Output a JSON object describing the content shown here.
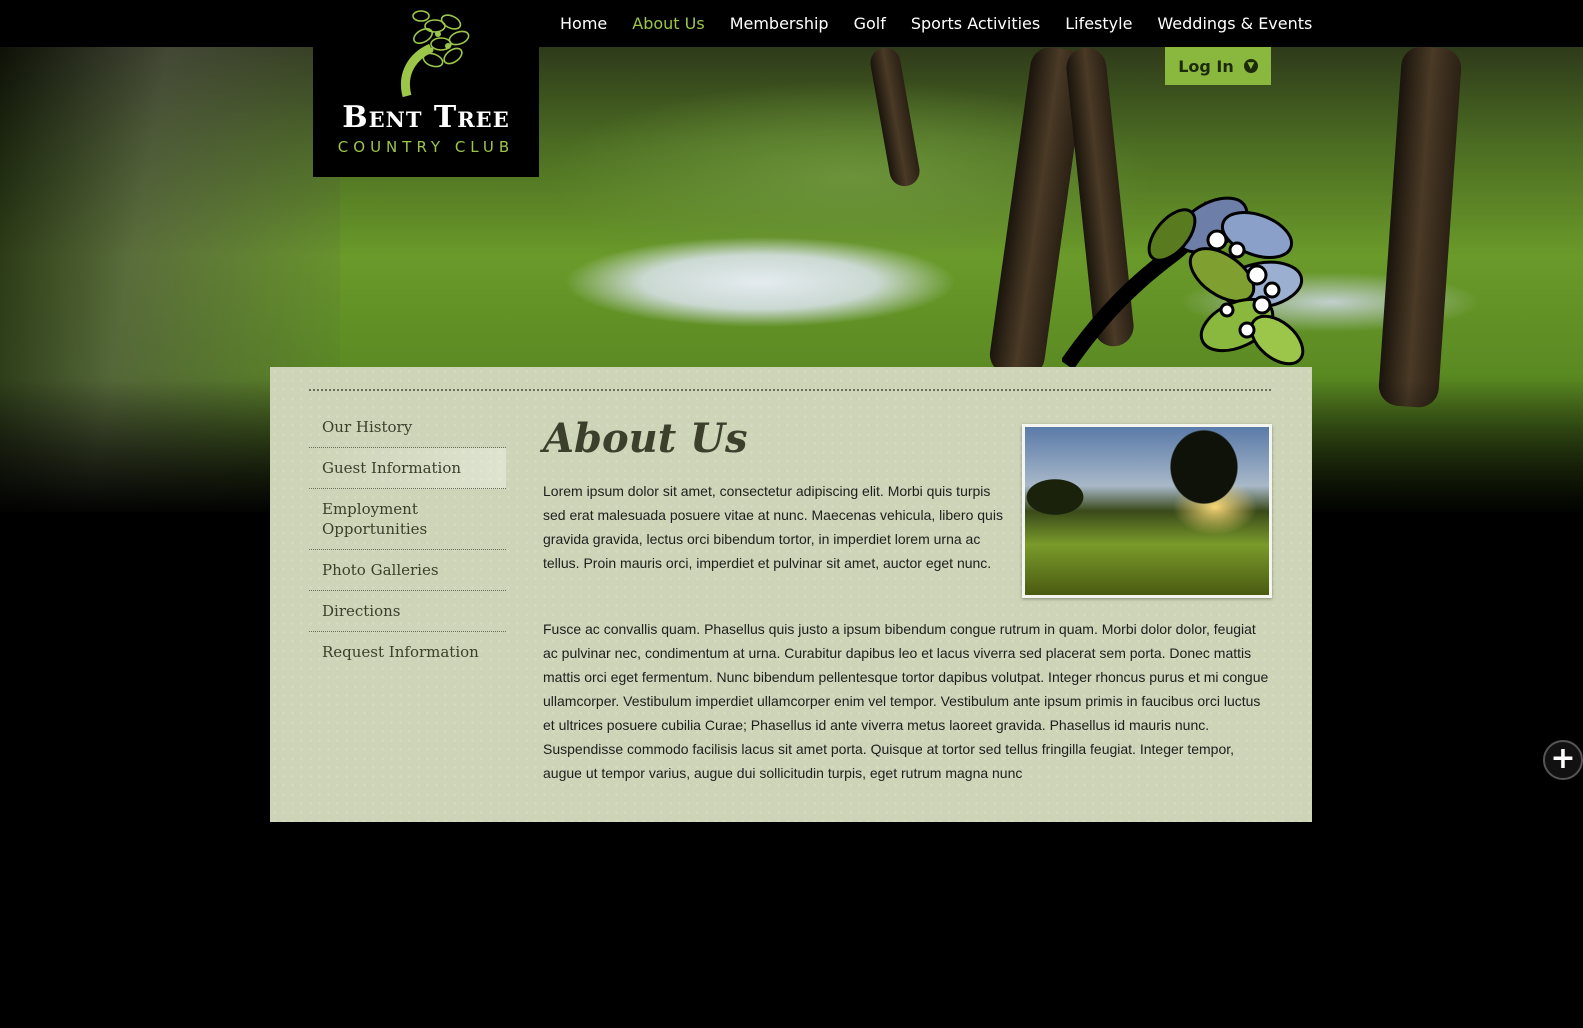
{
  "brand": {
    "name": "Bent Tree",
    "subtitle": "COUNTRY CLUB"
  },
  "nav": {
    "items": [
      {
        "label": "Home",
        "active": false
      },
      {
        "label": "About Us",
        "active": true
      },
      {
        "label": "Membership",
        "active": false
      },
      {
        "label": "Golf",
        "active": false
      },
      {
        "label": "Sports Activities",
        "active": false
      },
      {
        "label": "Lifestyle",
        "active": false
      },
      {
        "label": "Weddings & Events",
        "active": false
      }
    ]
  },
  "login": {
    "label": "Log In",
    "icon": "chevron-down-circle-icon"
  },
  "sidebar": {
    "items": [
      {
        "label": "Our History"
      },
      {
        "label": "Guest Information"
      },
      {
        "label": "Employment Opportunities"
      },
      {
        "label": "Photo Galleries"
      },
      {
        "label": "Directions"
      },
      {
        "label": "Request Information"
      }
    ]
  },
  "main": {
    "title": "About Us",
    "paragraph1": "Lorem ipsum dolor sit amet, consectetur adipiscing elit. Morbi quis turpis sed erat malesuada posuere vitae at nunc. Maecenas vehicula, libero quis gravida gravida, lectus orci bibendum tortor, in imperdiet lorem urna ac tellus. Proin mauris orci, imperdiet et pulvinar sit amet, auctor eget nunc.",
    "paragraph2": "Fusce ac convallis quam. Phasellus quis justo a ipsum bibendum congue rutrum in quam. Morbi dolor dolor, feugiat ac pulvinar nec, condimentum at urna. Curabitur dapibus leo et lacus viverra sed placerat sem porta. Donec mattis mattis orci eget fermentum. Nunc bibendum pellentesque tortor dapibus volutpat. Integer rhoncus purus et mi congue ullamcorper. Vestibulum imperdiet ullamcorper enim vel tempor. Vestibulum ante ipsum primis in faucibus orci luctus et ultrices posuere cubilia Curae; Phasellus id ante viverra metus laoreet gravida. Phasellus id mauris nunc. Suspendisse commodo facilisis lacus sit amet porta. Quisque at tortor sed tellus fringilla feugiat. Integer tempor, augue ut tempor varius, augue dui sollicitudin turpis, eget rutrum magna nunc"
  },
  "colors": {
    "accent": "#9bc64a",
    "login_bg": "#8ab83e",
    "panel_bg": "#cdd4b7",
    "text_dark": "#3b3f2c"
  },
  "floating": {
    "icon": "plus-icon"
  }
}
